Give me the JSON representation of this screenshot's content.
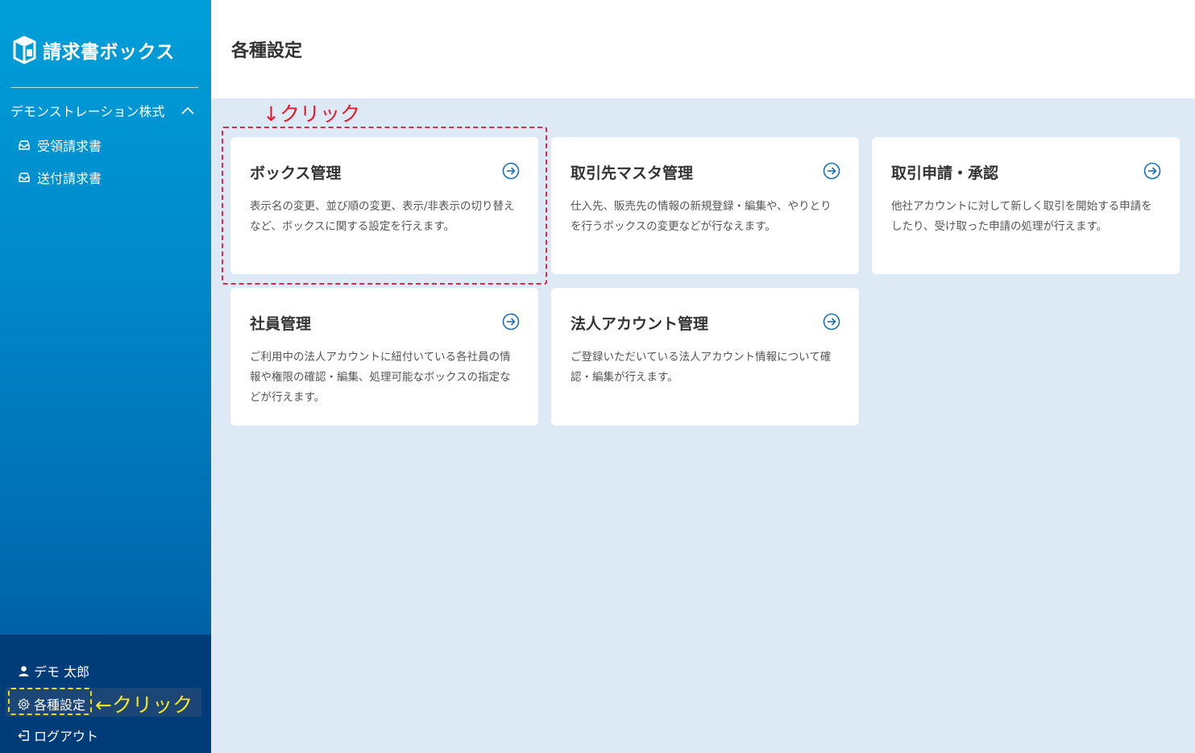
{
  "app": {
    "name": "請求書ボックス"
  },
  "sidebar": {
    "company": "デモンストレーション株式",
    "items": [
      {
        "label": "受領請求書",
        "icon": "inbox-icon"
      },
      {
        "label": "送付請求書",
        "icon": "inbox-icon"
      }
    ],
    "bottom": {
      "user": "デモ 太郎",
      "settings": "各種設定",
      "logout": "ログアウト"
    }
  },
  "header": {
    "title": "各種設定"
  },
  "cards": [
    {
      "title": "ボックス管理",
      "desc": "表示名の変更、並び順の変更、表示/非表示の切り替えなど、ボックスに関する設定を行えます。"
    },
    {
      "title": "取引先マスタ管理",
      "desc": "仕入先、販売先の情報の新規登録・編集や、やりとりを行うボックスの変更などが行なえます。"
    },
    {
      "title": "取引申請・承認",
      "desc": "他社アカウントに対して新しく取引を開始する申請をしたり、受け取った申請の処理が行えます。"
    },
    {
      "title": "社員管理",
      "desc": "ご利用中の法人アカウントに紐付いている各社員の情報や権限の確認・編集、処理可能なボックスの指定などが行えます。"
    },
    {
      "title": "法人アカウント管理",
      "desc": "ご登録いただいている法人アカウント情報について確認・編集が行えます。"
    }
  ],
  "annotations": {
    "top": "↓クリック",
    "side": "←クリック"
  },
  "colors": {
    "sidebar_top": "#009fd9",
    "sidebar_bottom": "#003c78",
    "content_bg": "#dde9f5",
    "accent": "#1a6fb5",
    "annotation_red": "#e3182d",
    "annotation_yellow": "#f5e81a"
  }
}
